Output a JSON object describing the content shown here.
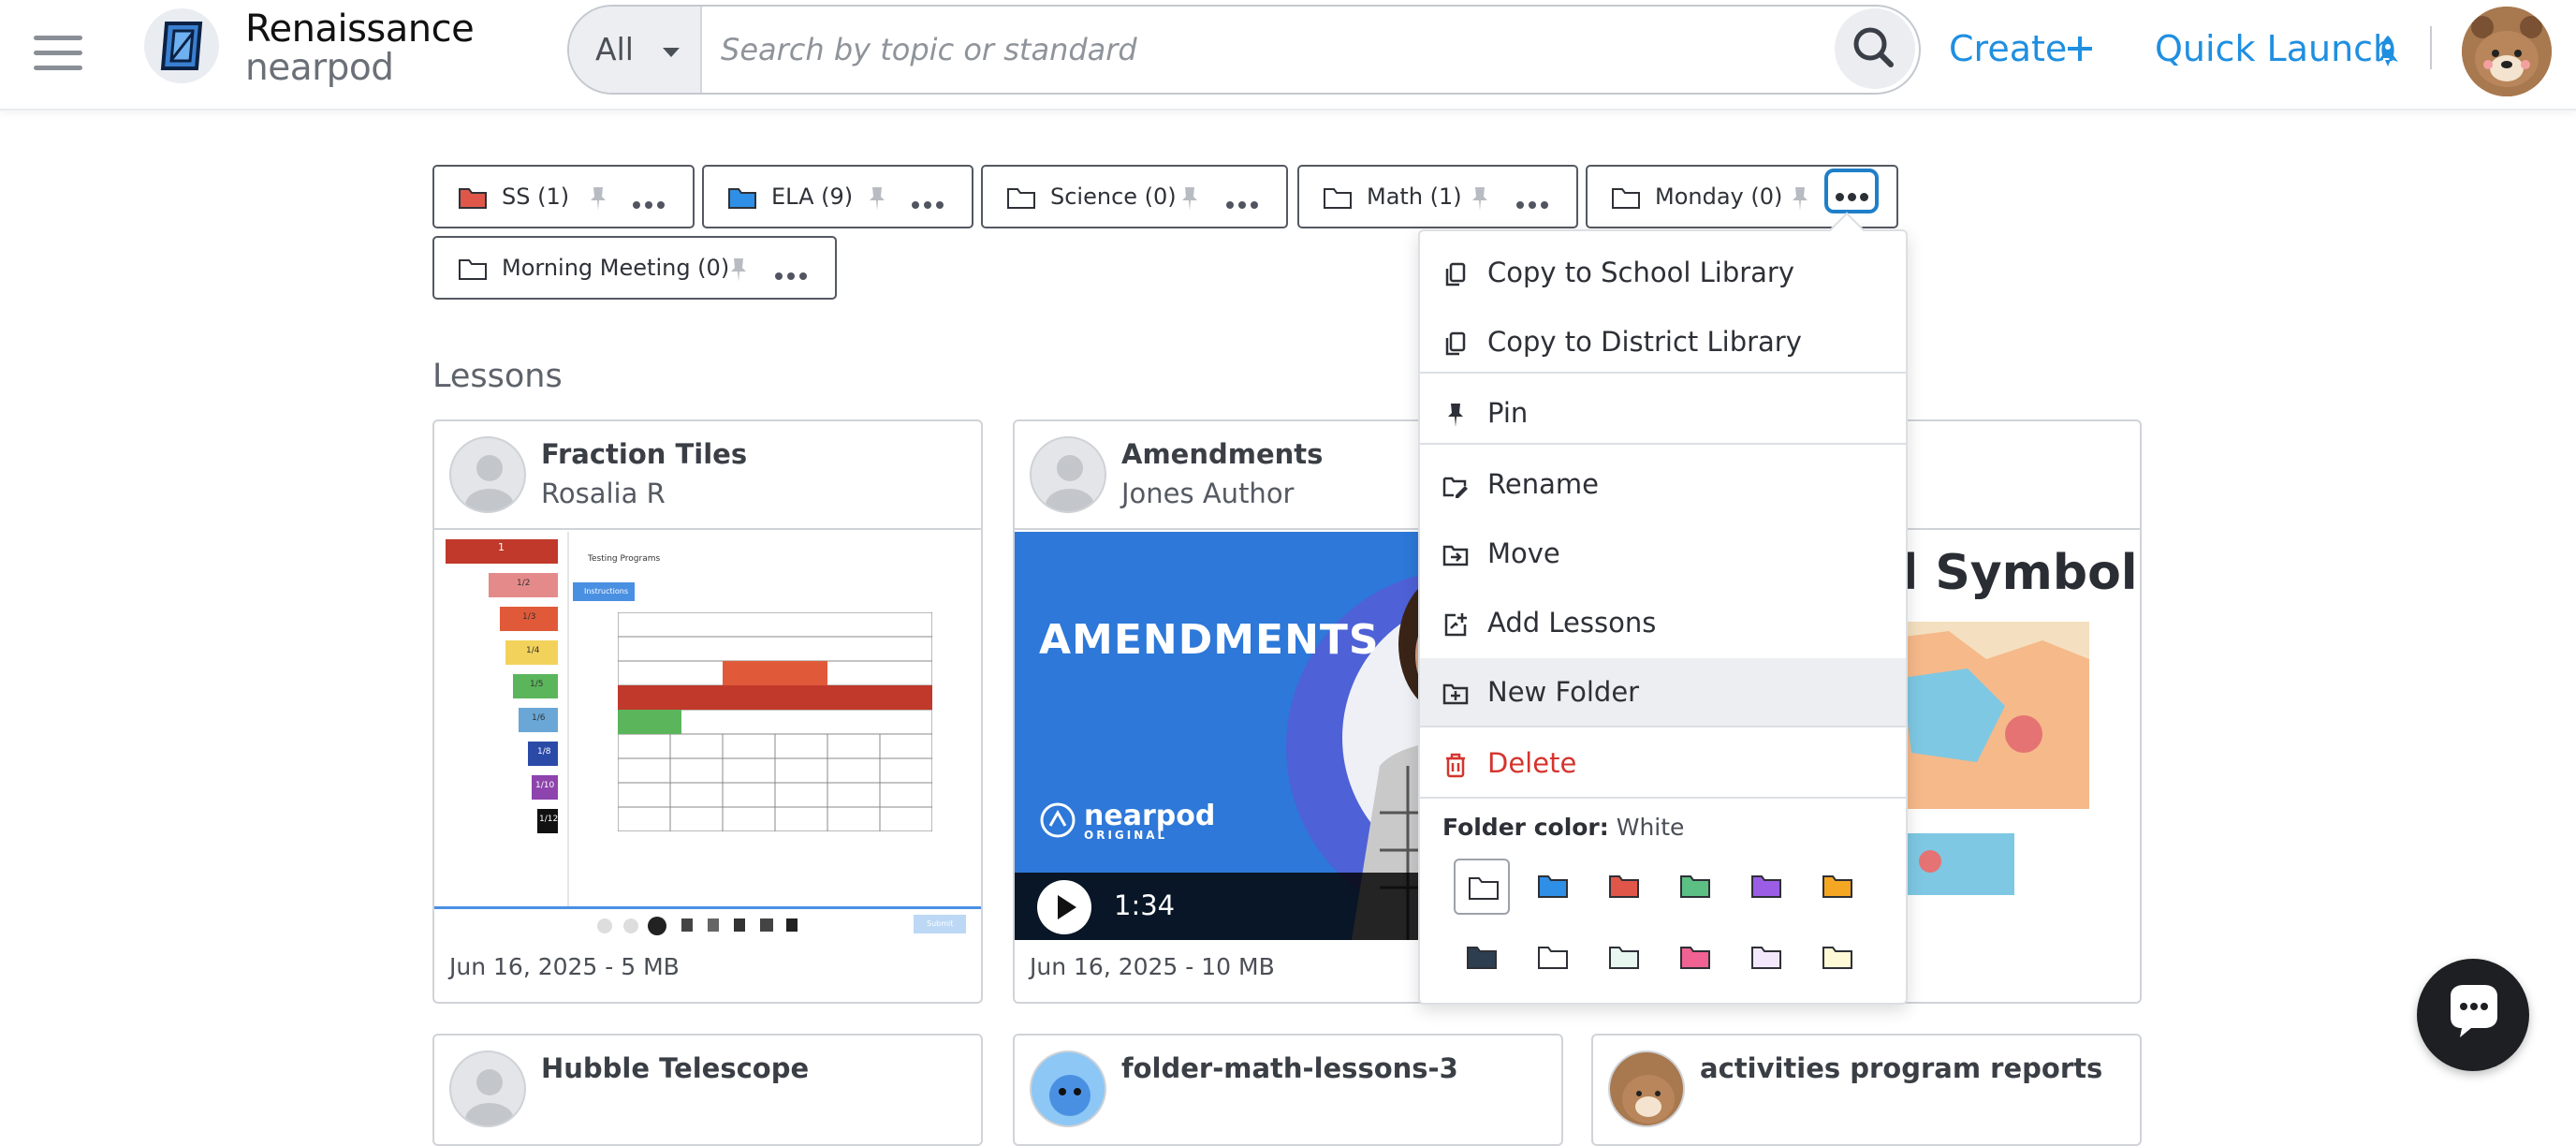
{
  "header": {
    "brand_line1": "Renaissance",
    "brand_line2": "nearpod",
    "search": {
      "category": "All",
      "placeholder": "Search by topic or standard"
    },
    "create_label": "Create",
    "quick_launch_label": "Quick Launch"
  },
  "folders": [
    {
      "label": "SS (1)",
      "color": "#e0574a"
    },
    {
      "label": "ELA (9)",
      "color": "#2f8fe6"
    },
    {
      "label": "Science (0)",
      "color": "#ffffff"
    },
    {
      "label": "Math (1)",
      "color": "#ffffff"
    },
    {
      "label": "Monday (0)",
      "color": "#ffffff"
    },
    {
      "label": "Morning Meeting (0)",
      "color": "#ffffff"
    }
  ],
  "section_title": "Lessons",
  "lessons": [
    {
      "title": "Fraction Tiles",
      "author": "Rosalia R",
      "meta": "Jun 16, 2025 - 5 MB"
    },
    {
      "title": "Amendments",
      "author": "Jones Author",
      "meta": "Jun 16, 2025 - 10 MB",
      "video_title": "AMENDMENTS",
      "video_badge": "nearpod",
      "video_badge_sub": "ORIGINAL",
      "duration": "1:34"
    },
    {
      "thumb_title": "d Symbols"
    },
    {
      "title": "Hubble Telescope"
    },
    {
      "title": "folder-math-lessons-3"
    },
    {
      "title": "activities program reports"
    }
  ],
  "fraction_tiles": [
    "1",
    "1/2",
    "1/3",
    "1/4",
    "1/5",
    "1/6",
    "1/8",
    "1/10",
    "1/12"
  ],
  "fraction_thumb": {
    "heading": "Testing Programs",
    "instructions": "Instructions",
    "submit": "Submit"
  },
  "menu": {
    "items": [
      {
        "label": "Copy to School Library",
        "icon": "copy-icon"
      },
      {
        "label": "Copy to District Library",
        "icon": "copy-icon"
      },
      {
        "label": "Pin",
        "icon": "pin-icon"
      },
      {
        "label": "Rename",
        "icon": "rename-icon"
      },
      {
        "label": "Move",
        "icon": "move-icon"
      },
      {
        "label": "Add Lessons",
        "icon": "add-lessons-icon"
      },
      {
        "label": "New Folder",
        "icon": "new-folder-icon"
      },
      {
        "label": "Delete",
        "icon": "trash-icon"
      }
    ],
    "folder_color_label": "Folder color:",
    "folder_color_value": "White",
    "swatches": [
      "#ffffff",
      "#2f8fe6",
      "#e0574a",
      "#5cbf84",
      "#9b5de5",
      "#f5a623",
      "#2c3e50",
      "#ffffff",
      "#e8f7ef",
      "#f06292",
      "#f3e8fb",
      "#fff9d6"
    ]
  },
  "colors": {
    "accent": "#1f8fe0",
    "danger": "#d5342d"
  }
}
